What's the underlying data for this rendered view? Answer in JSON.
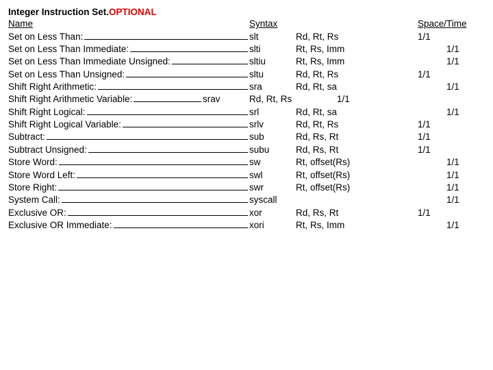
{
  "title": {
    "prefix": "Integer Instruction Set.",
    "suffix": "OPTIONAL"
  },
  "headers": {
    "name": "Name",
    "syntax": "Syntax",
    "st": "Space/Time"
  },
  "rows": [
    {
      "name": "Set on Less Than:",
      "syn": "slt",
      "ops": "Rd, Rt, Rs",
      "st_a": "1/1",
      "st_b": ""
    },
    {
      "name": "Set on Less Than Immediate:  ",
      "syn": "slti",
      "ops": "Rt, Rs, Imm",
      "st_a": "",
      "st_b": "1/1"
    },
    {
      "name": "Set on Less Than Immediate Unsigned: ",
      "syn": "sltiu",
      "ops": "Rt, Rs, Imm",
      "st_a": "",
      "st_b": "1/1"
    },
    {
      "name": "Set on Less Than Unsigned: ",
      "syn": "sltu",
      "ops": "Rd, Rt, Rs",
      "st_a": "1/1",
      "st_b": ""
    },
    {
      "name": "Shift Right Arithmetic: ",
      "syn": "sra",
      "ops": "Rd, Rt, sa",
      "st_a": "",
      "st_b": "1/1"
    },
    {
      "name": "Shift Right Arithmetic Variable: ",
      "syn": "srav",
      "ops": "Rd, Rt, Rs",
      "st_a": "1/1",
      "st_b": "",
      "variant": "offset1"
    },
    {
      "name": "Shift Right Logical: ",
      "syn": "srl",
      "ops": "Rd, Rt, sa",
      "st_a": "",
      "st_b": "1/1"
    },
    {
      "name": "Shift Right Logical Variable: ",
      "syn": "srlv",
      "ops": "Rd, Rt, Rs",
      "st_a": "1/1",
      "st_b": ""
    },
    {
      "name": "Subtract: ",
      "syn": "sub",
      "ops": "Rd, Rs, Rt",
      "st_a": "1/1",
      "st_b": ""
    },
    {
      "name": "Subtract Unsigned: ",
      "syn": "subu",
      "ops": "Rd, Rs, Rt",
      "st_a": "1/1",
      "st_b": ""
    },
    {
      "name": "Store Word: ",
      "syn": "sw",
      "ops": "Rt, offset(Rs)",
      "st_a": "",
      "st_b": "1/1"
    },
    {
      "name": "Store Word Left: ",
      "syn": "swl",
      "ops": "Rt, offset(Rs)",
      "st_a": "",
      "st_b": "1/1"
    },
    {
      "name": "Store Right:   ",
      "syn": "swr",
      "ops": "Rt, offset(Rs)",
      "st_a": "",
      "st_b": "1/1"
    },
    {
      "name": "System Call:  ",
      "syn": "syscall",
      "ops": "",
      "st_a": "",
      "st_b": "1/1"
    },
    {
      "name": "Exclusive OR:   ",
      "syn": "xor",
      "ops": "Rd, Rs, Rt",
      "st_a": "1/1",
      "st_b": ""
    },
    {
      "name": "Exclusive OR Immediate:  ",
      "syn": "xori",
      "ops": "Rt, Rs, Imm",
      "st_a": "",
      "st_b": "1/1"
    }
  ]
}
